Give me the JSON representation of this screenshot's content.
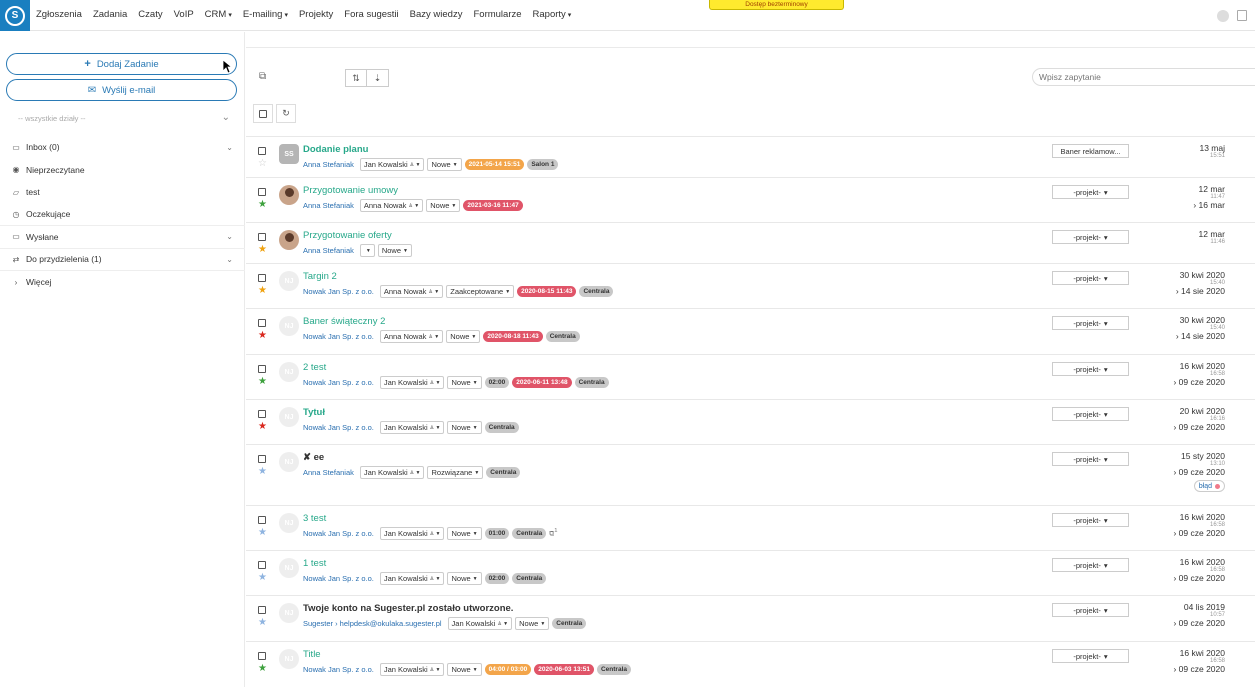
{
  "topbar": {
    "logo": "S",
    "nav": [
      {
        "label": "Zgłoszenia",
        "caret": false
      },
      {
        "label": "Zadania",
        "caret": false
      },
      {
        "label": "Czaty",
        "caret": false
      },
      {
        "label": "VoIP",
        "caret": false
      },
      {
        "label": "CRM",
        "caret": true
      },
      {
        "label": "E-mailing",
        "caret": true
      },
      {
        "label": "Projekty",
        "caret": false
      },
      {
        "label": "Fora sugestii",
        "caret": false
      },
      {
        "label": "Bazy wiedzy",
        "caret": false
      },
      {
        "label": "Formularze",
        "caret": false
      },
      {
        "label": "Raporty",
        "caret": true
      }
    ],
    "trial_badge": "Dostęp bezterminowy"
  },
  "sidebar": {
    "add_task": "Dodaj Zadanie",
    "send_email": "Wyślij e-mail",
    "dept_placeholder": "-- wszystkie działy --",
    "items": [
      {
        "label": "Inbox (0)",
        "icon": "inbox-icon",
        "glyph": "▭",
        "chevron": true,
        "bordered": false
      },
      {
        "label": "Nieprzeczytane",
        "icon": "eye-icon",
        "glyph": "◉",
        "chevron": false,
        "bordered": false
      },
      {
        "label": "test",
        "icon": "folder-icon",
        "glyph": "▱",
        "chevron": false,
        "bordered": false
      },
      {
        "label": "Oczekujące",
        "icon": "clock-icon",
        "glyph": "◷",
        "chevron": false,
        "bordered": true
      },
      {
        "label": "Wysłane",
        "icon": "outbox-icon",
        "glyph": "▭",
        "chevron": true,
        "bordered": true
      },
      {
        "label": "Do przydzielenia (1)",
        "icon": "exchange-icon",
        "glyph": "⇄",
        "chevron": true,
        "bordered": true
      },
      {
        "label": "Więcej",
        "icon": "chevron-right-icon",
        "glyph": "›",
        "chevron": false,
        "bordered": false
      }
    ]
  },
  "toolbar": {
    "search_placeholder": "Wpisz zapytanie"
  },
  "tasks": [
    {
      "title": "Dodanie planu",
      "title_style": "bold",
      "avatar": "SS",
      "avatar_type": "initials",
      "star": "empty",
      "requester": "Anna Stefaniak",
      "assignee": "Jan Kowalski",
      "status": "Nowe",
      "time": "",
      "deadline": "2021-05-14 15:51",
      "deadline_color": "orange",
      "group": "Salon 1",
      "attach": "",
      "project": "Baner reklamow...",
      "date": "13 maj",
      "date_time": "15:51",
      "due": "",
      "tag": ""
    },
    {
      "title": "Przygotowanie umowy",
      "title_style": "",
      "avatar": "",
      "avatar_type": "photo",
      "star": "green",
      "requester": "Anna Stefaniak",
      "assignee": "Anna Nowak",
      "status": "Nowe",
      "time": "",
      "deadline": "2021-03-16 11:47",
      "deadline_color": "red",
      "group": "",
      "attach": "",
      "project": "-projekt-",
      "date": "12 mar",
      "date_time": "11:47",
      "due": "› 16 mar",
      "tag": ""
    },
    {
      "title": "Przygotowanie oferty",
      "title_style": "",
      "avatar": "",
      "avatar_type": "photo",
      "star": "orange",
      "requester": "Anna Stefaniak",
      "assignee": "",
      "status": "Nowe",
      "time": "",
      "deadline": "",
      "deadline_color": "",
      "group": "",
      "attach": "",
      "project": "-projekt-",
      "date": "12 mar",
      "date_time": "11:46",
      "due": "",
      "tag": ""
    },
    {
      "title": "Targin 2",
      "title_style": "",
      "avatar": "NJ",
      "avatar_type": "initials-light",
      "star": "orange",
      "requester": "Nowak Jan Sp. z o.o.",
      "assignee": "Anna Nowak",
      "status": "Zaakceptowane",
      "time": "",
      "deadline": "2020-08-15 11:43",
      "deadline_color": "red",
      "group": "Centrala",
      "attach": "",
      "project": "-projekt-",
      "date": "30 kwi 2020",
      "date_time": "15:40",
      "due": "› 14 sie 2020",
      "tag": ""
    },
    {
      "title": "Baner świąteczny 2",
      "title_style": "",
      "avatar": "NJ",
      "avatar_type": "initials-light",
      "star": "red",
      "requester": "Nowak Jan Sp. z o.o.",
      "assignee": "Anna Nowak",
      "status": "Nowe",
      "time": "",
      "deadline": "2020-08-18 11:43",
      "deadline_color": "red",
      "group": "Centrala",
      "attach": "",
      "project": "-projekt-",
      "date": "30 kwi 2020",
      "date_time": "15:40",
      "due": "› 14 sie 2020",
      "tag": ""
    },
    {
      "title": "2 test",
      "title_style": "",
      "avatar": "NJ",
      "avatar_type": "initials-light",
      "star": "green",
      "requester": "Nowak Jan Sp. z o.o.",
      "assignee": "Jan Kowalski",
      "status": "Nowe",
      "time": "02:00",
      "deadline": "2020-06-11 13:48",
      "deadline_color": "red",
      "group": "Centrala",
      "attach": "",
      "project": "-projekt-",
      "date": "16 kwi 2020",
      "date_time": "16:58",
      "due": "› 09 cze 2020",
      "tag": ""
    },
    {
      "title": "Tytuł",
      "title_style": "bold",
      "avatar": "NJ",
      "avatar_type": "initials-light",
      "star": "red",
      "requester": "Nowak Jan Sp. z o.o.",
      "assignee": "Jan Kowalski",
      "status": "Nowe",
      "time": "",
      "deadline": "",
      "deadline_color": "",
      "group": "Centrala",
      "attach": "",
      "project": "-projekt-",
      "date": "20 kwi 2020",
      "date_time": "16:16",
      "due": "› 09 cze 2020",
      "tag": ""
    },
    {
      "title": "✘ ee",
      "title_style": "dark",
      "avatar": "NJ",
      "avatar_type": "initials-light",
      "star": "blue",
      "requester": "Anna Stefaniak",
      "assignee": "Jan Kowalski",
      "status": "Rozwiązane",
      "time": "",
      "deadline": "",
      "deadline_color": "",
      "group": "Centrala",
      "attach": "",
      "project": "-projekt-",
      "date": "15 sty 2020",
      "date_time": "13:10",
      "due": "› 09 cze 2020",
      "tag": "błąd"
    },
    {
      "title": "3 test",
      "title_style": "",
      "avatar": "NJ",
      "avatar_type": "initials-light",
      "star": "blue",
      "requester": "Nowak Jan Sp. z o.o.",
      "assignee": "Jan Kowalski",
      "status": "Nowe",
      "time": "01:00",
      "deadline": "",
      "deadline_color": "",
      "group": "Centrala",
      "attach": "1",
      "project": "-projekt-",
      "date": "16 kwi 2020",
      "date_time": "16:58",
      "due": "› 09 cze 2020",
      "tag": ""
    },
    {
      "title": "1 test",
      "title_style": "",
      "avatar": "NJ",
      "avatar_type": "initials-light",
      "star": "blue",
      "requester": "Nowak Jan Sp. z o.o.",
      "assignee": "Jan Kowalski",
      "status": "Nowe",
      "time": "02:00",
      "deadline": "",
      "deadline_color": "",
      "group": "Centrala",
      "attach": "",
      "project": "-projekt-",
      "date": "16 kwi 2020",
      "date_time": "16:58",
      "due": "› 09 cze 2020",
      "tag": ""
    },
    {
      "title": "Twoje konto na Sugester.pl zostało utworzone.",
      "title_style": "dark",
      "avatar": "NJ",
      "avatar_type": "initials-light",
      "star": "blue",
      "requester": "Sugester › helpdesk@okulaka.sugester.pl",
      "assignee": "Jan Kowalski",
      "status": "Nowe",
      "time": "",
      "deadline": "",
      "deadline_color": "",
      "group": "Centrala",
      "attach": "",
      "project": "-projekt-",
      "date": "04 lis 2019",
      "date_time": "10:57",
      "due": "› 09 cze 2020",
      "tag": ""
    },
    {
      "title": "Title",
      "title_style": "",
      "avatar": "NJ",
      "avatar_type": "initials-light",
      "star": "green",
      "requester": "Nowak Jan Sp. z o.o.",
      "assignee": "Jan Kowalski",
      "status": "Nowe",
      "time": "04:00 / 03:00",
      "time_color": "orange",
      "deadline": "2020-06-03 13:51",
      "deadline_color": "red",
      "group": "Centrala",
      "attach": "",
      "project": "-projekt-",
      "date": "16 kwi 2020",
      "date_time": "16:58",
      "due": "› 09 cze 2020",
      "tag": ""
    }
  ]
}
